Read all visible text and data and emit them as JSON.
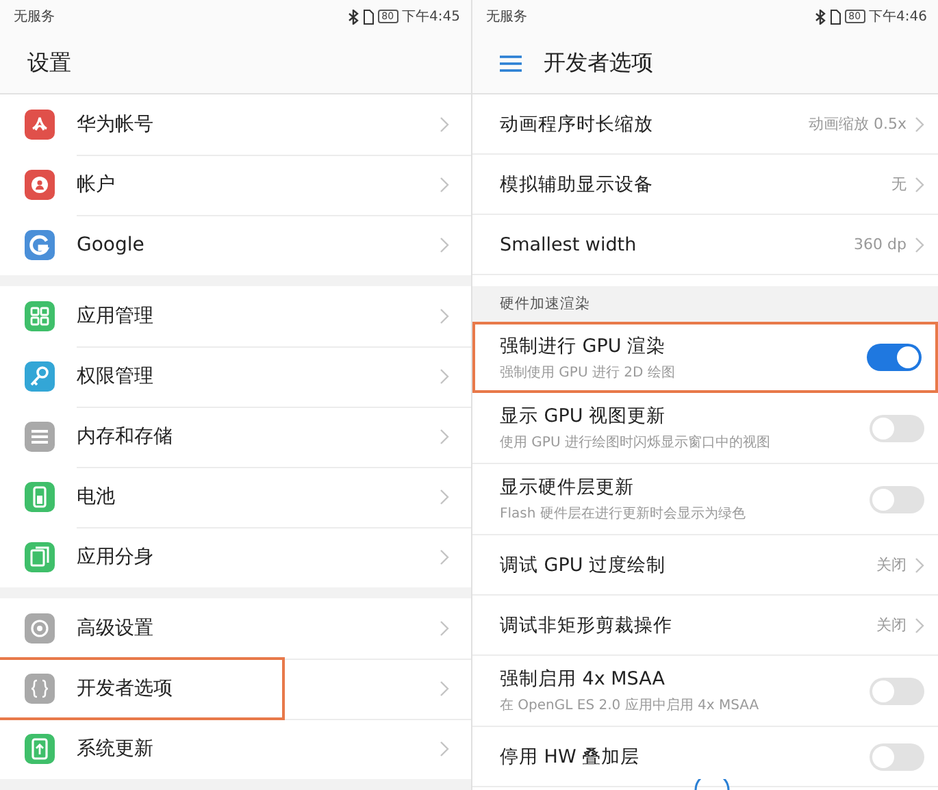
{
  "left_screen": {
    "status_bar": {
      "carrier": "无服务",
      "battery": "80",
      "time": "下午4:45"
    },
    "title": "设置",
    "groups": [
      {
        "items": [
          {
            "label": "华为帐号",
            "color": "#e0504a",
            "highlighted": false
          },
          {
            "label": "帐户",
            "color": "#e0504a",
            "highlighted": false
          },
          {
            "label": "Google",
            "color": "#4a8fd8",
            "highlighted": false
          }
        ]
      },
      {
        "items": [
          {
            "label": "应用管理",
            "color": "#3fbf6a",
            "highlighted": false
          },
          {
            "label": "权限管理",
            "color": "#33a6d6",
            "highlighted": false
          },
          {
            "label": "内存和存储",
            "color": "#a9a9a9",
            "highlighted": false
          },
          {
            "label": "电池",
            "color": "#3fbf6a",
            "highlighted": false
          },
          {
            "label": "应用分身",
            "color": "#3fbf6a",
            "highlighted": false
          }
        ]
      },
      {
        "items": [
          {
            "label": "高级设置",
            "color": "#a9a9a9",
            "highlighted": false
          },
          {
            "label": "开发者选项",
            "color": "#a9a9a9",
            "highlighted": true
          },
          {
            "label": "系统更新",
            "color": "#3fbf6a",
            "highlighted": false
          }
        ]
      }
    ]
  },
  "right_screen": {
    "status_bar": {
      "carrier": "无服务",
      "battery": "80",
      "time": "下午4:46"
    },
    "title": "开发者选项",
    "items": [
      {
        "kind": "value",
        "title": "动画程序时长缩放",
        "value": "动画缩放 0.5x",
        "highlighted": false
      },
      {
        "kind": "value",
        "title": "模拟辅助显示设备",
        "value": "无",
        "highlighted": false
      },
      {
        "kind": "value",
        "title": "Smallest width",
        "value": "360 dp",
        "highlighted": false
      },
      {
        "kind": "section",
        "title": "硬件加速渲染"
      },
      {
        "kind": "toggle",
        "title": "强制进行 GPU 渲染",
        "subtitle": "强制使用 GPU 进行 2D 绘图",
        "on": true,
        "highlighted": true
      },
      {
        "kind": "toggle",
        "title": "显示 GPU 视图更新",
        "subtitle": "使用 GPU 进行绘图时闪烁显示窗口中的视图",
        "on": false,
        "highlighted": false
      },
      {
        "kind": "toggle",
        "title": "显示硬件层更新",
        "subtitle": "Flash 硬件层在进行更新时会显示为绿色",
        "on": false,
        "highlighted": false
      },
      {
        "kind": "value",
        "title": "调试 GPU 过度绘制",
        "value": "关闭",
        "highlighted": false
      },
      {
        "kind": "value",
        "title": "调试非矩形剪裁操作",
        "value": "关闭",
        "highlighted": false
      },
      {
        "kind": "toggle",
        "title": "强制启用 4x MSAA",
        "subtitle": "在 OpenGL ES 2.0 应用中启用 4x MSAA",
        "on": false,
        "highlighted": false
      },
      {
        "kind": "toggle",
        "title": "停用 HW 叠加层",
        "on": false,
        "highlighted": false
      }
    ]
  }
}
